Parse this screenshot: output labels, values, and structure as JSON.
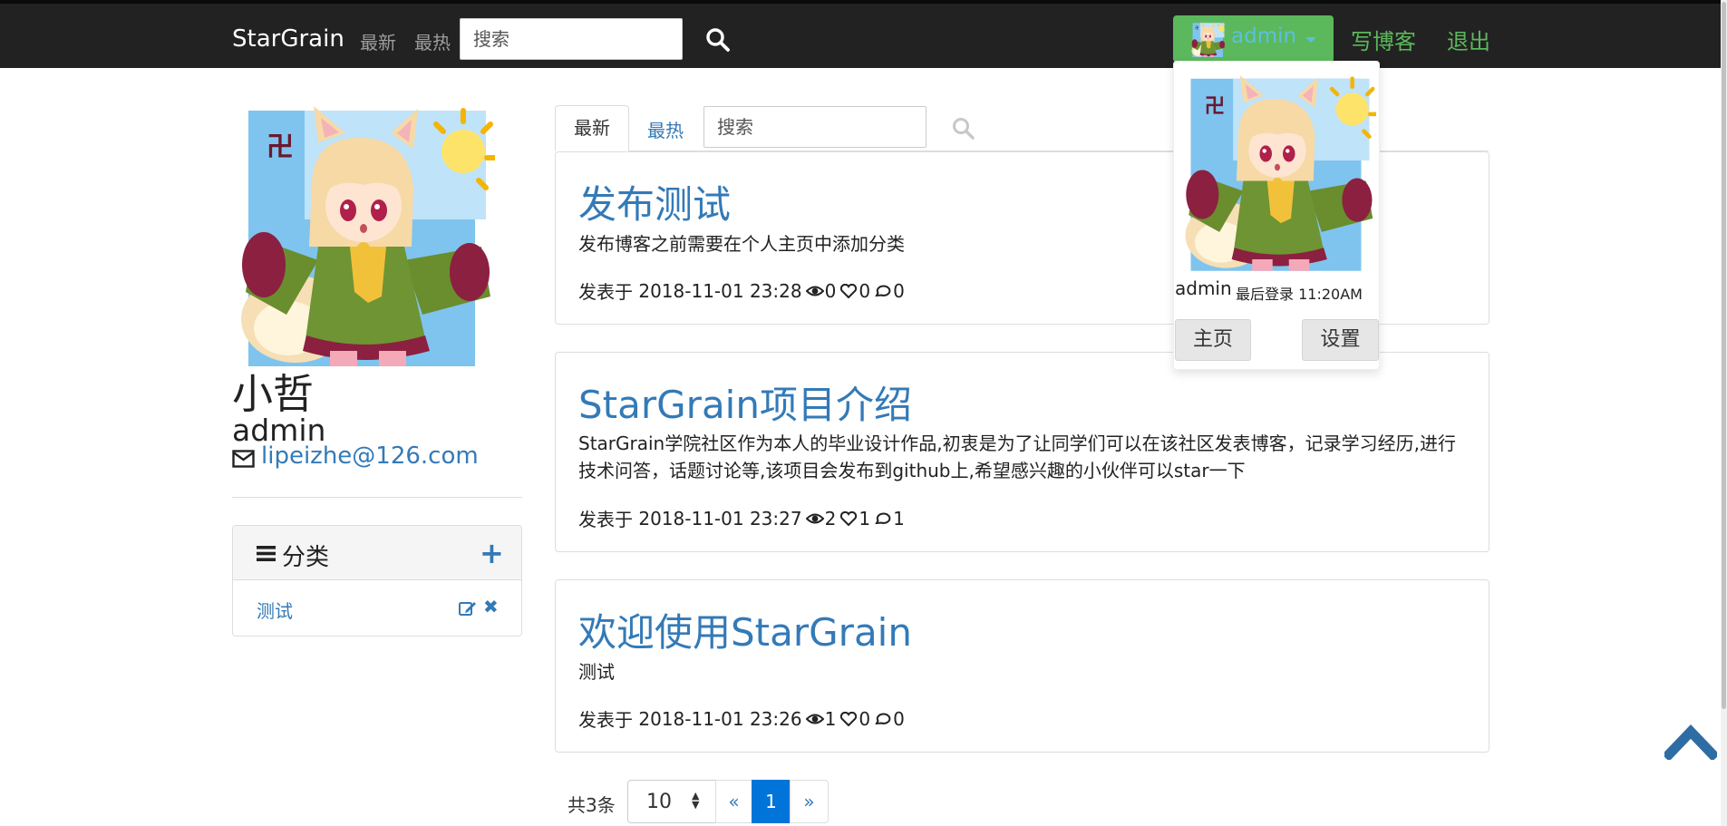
{
  "navbar": {
    "brand": "StarGrain",
    "links": [
      "最新",
      "最热"
    ],
    "search_placeholder": "搜索",
    "user_name": "admin",
    "write_blog": "写博客",
    "logout": "退出"
  },
  "user_dropdown": {
    "name": "admin",
    "last_login": "最后登录 11:20AM",
    "home_button": "主页",
    "settings_button": "设置"
  },
  "profile": {
    "display_name": "小哲",
    "username": "admin",
    "email": "lipeizhe@126.com"
  },
  "categories": {
    "title": "分类",
    "items": [
      {
        "name": "测试"
      }
    ]
  },
  "content_tabs": {
    "tabs": [
      "最新",
      "最热"
    ],
    "active": "最新",
    "search_placeholder": "搜索"
  },
  "posts": [
    {
      "title": "发布测试",
      "summary": "发布博客之前需要在个人主页中添加分类",
      "posted_label": "发表于",
      "date": "2018-11-01 23:28",
      "views": "0",
      "likes": "0",
      "comments": "0"
    },
    {
      "title": "StarGrain项目介绍",
      "summary": "StarGrain学院社区作为本人的毕业设计作品,初衷是为了让同学们可以在该社区发表博客，记录学习经历,进行技术问答，话题讨论等,该项目会发布到github上,希望感兴趣的小伙伴可以star一下",
      "posted_label": "发表于",
      "date": "2018-11-01 23:27",
      "views": "2",
      "likes": "1",
      "comments": "1"
    },
    {
      "title": "欢迎使用StarGrain",
      "summary": "测试",
      "posted_label": "发表于",
      "date": "2018-11-01 23:26",
      "views": "1",
      "likes": "0",
      "comments": "0"
    }
  ],
  "pagination": {
    "total_label": "共3条",
    "page_size": "10",
    "prev": "«",
    "current_page": "1",
    "next": "»"
  },
  "colors": {
    "navbar_bg": "#222222",
    "accent_blue": "#337ab7",
    "success_green": "#5cb85c",
    "active_page_blue": "#0074d9"
  },
  "icons": {
    "search": "search-icon",
    "views": "eye-icon",
    "likes": "heart-icon",
    "comments": "comment-icon",
    "category_list": "list-icon",
    "add_category": "plus-icon",
    "edit_category": "edit-icon",
    "delete_category": "close-icon",
    "email": "envelope-icon",
    "back_to_top": "chevron-up-icon"
  }
}
